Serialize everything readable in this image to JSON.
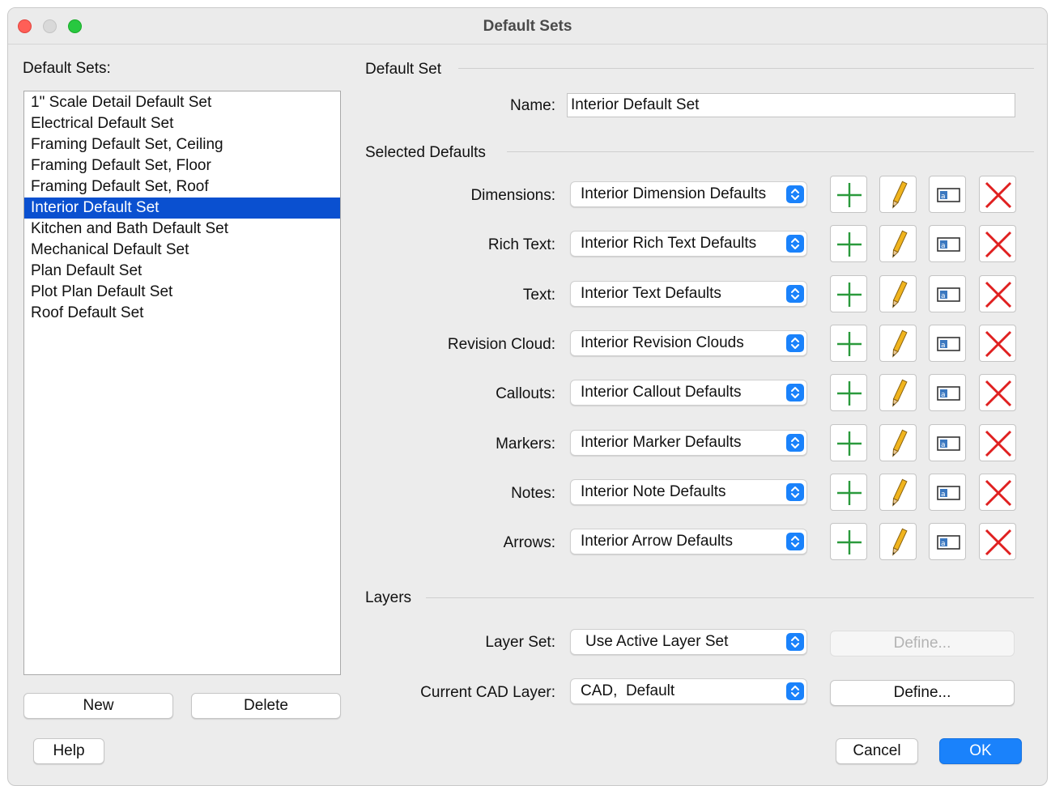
{
  "window": {
    "title": "Default Sets"
  },
  "left": {
    "list_label": "Default Sets:",
    "items": [
      "1\" Scale Detail Default Set",
      "Electrical Default Set",
      "Framing Default Set, Ceiling",
      "Framing Default Set, Floor",
      "Framing Default Set, Roof",
      "Interior Default Set",
      "Kitchen and Bath Default Set",
      "Mechanical Default Set",
      "Plan Default Set",
      "Plot Plan Default Set",
      "Roof Default Set"
    ],
    "selected_item": "Interior Default Set",
    "new_label": "New",
    "delete_label": "Delete"
  },
  "default_set": {
    "section_title": "Default Set",
    "name_label": "Name:",
    "name_value": "Interior Default Set"
  },
  "selected_defaults": {
    "section_title": "Selected Defaults",
    "rows": [
      {
        "label": "Dimensions:",
        "value": "Interior Dimension Defaults"
      },
      {
        "label": "Rich Text:",
        "value": "Interior Rich Text Defaults"
      },
      {
        "label": "Text:",
        "value": "Interior Text Defaults"
      },
      {
        "label": "Revision Cloud:",
        "value": "Interior Revision Clouds"
      },
      {
        "label": "Callouts:",
        "value": "Interior Callout Defaults"
      },
      {
        "label": "Markers:",
        "value": "Interior Marker Defaults"
      },
      {
        "label": "Notes:",
        "value": "Interior Note Defaults"
      },
      {
        "label": "Arrows:",
        "value": "Interior Arrow Defaults"
      }
    ],
    "row_icons": [
      "plus-icon",
      "pencil-icon",
      "rename-icon",
      "delete-x-icon"
    ]
  },
  "layers": {
    "section_title": "Layers",
    "layer_set_label": "Layer Set:",
    "layer_set_value": "Use Active Layer Set",
    "layer_set_define_label": "Define...",
    "cad_layer_label": "Current CAD Layer:",
    "cad_layer_value": "CAD,  Default",
    "cad_layer_define_label": "Define..."
  },
  "footer": {
    "help_label": "Help",
    "cancel_label": "Cancel",
    "ok_label": "OK"
  },
  "colors": {
    "selection": "#0a50d0",
    "accent": "#1a82fb",
    "plus": "#2a9a3c",
    "delete": "#e02020",
    "pencil": "#f0b41e"
  }
}
